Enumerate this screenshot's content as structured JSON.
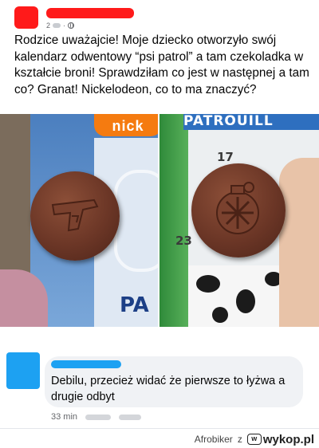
{
  "post": {
    "meta_visible": "2",
    "text": "Rodzice uważajcie! Moje dziecko otworzyło swój kalendarz odwentowy “psi patrol” a tam czekoladka w kształcie broni! Sprawdziłam co jest w następnej a tam co? Granat! Nickelodeon, co to ma znaczyć?"
  },
  "photos": {
    "left": {
      "logo_text": "nick",
      "bottom_text": "PA"
    },
    "right": {
      "banner_text": "PATROUILL",
      "day_numbers": [
        "17",
        "23"
      ]
    }
  },
  "comment": {
    "text": "Debilu, przecież widać że pierwsze to łyżwa a drugie odbyt",
    "time": "33 min"
  },
  "watermark": {
    "author": "Afrobiker",
    "separator": "z",
    "site": "wykop.pl"
  },
  "colors": {
    "redaction_red": "#ff1a1a",
    "redaction_blue": "#1da1f2",
    "bubble": "#f0f2f5"
  }
}
